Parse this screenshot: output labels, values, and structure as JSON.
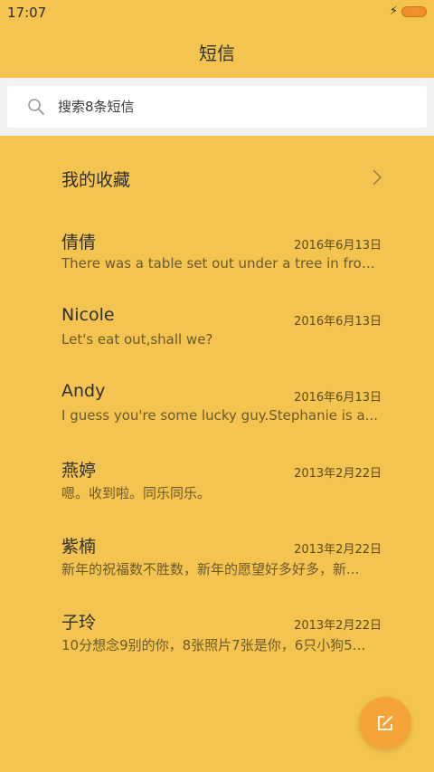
{
  "status_bar": {
    "time": "17:07",
    "icons": [
      "charging-bolt-icon",
      "battery-icon"
    ],
    "battery_color": "#F08F2B"
  },
  "header": {
    "title": "短信"
  },
  "search": {
    "placeholder": "搜索8条短信"
  },
  "favorites": {
    "label": "我的收藏"
  },
  "conversations": [
    {
      "name": "倩倩",
      "date": "2016年6月13日",
      "preview": "There was a table set out under a tree in front..."
    },
    {
      "name": "Nicole",
      "date": "2016年6月13日",
      "preview": "Let's eat out,shall we?"
    },
    {
      "name": "Andy",
      "date": "2016年6月13日",
      "preview": "I guess you're some lucky guy.Stephanie is a..."
    },
    {
      "name": "燕婷",
      "date": "2013年2月22日",
      "preview": "嗯。收到啦。同乐同乐。"
    },
    {
      "name": "紫楠",
      "date": "2013年2月22日",
      "preview": "新年的祝福数不胜数，新年的愿望好多好多，新..."
    },
    {
      "name": "子玲",
      "date": "2013年2月22日",
      "preview": "10分想念9别的你，8张照片7张是你，6只小狗5..."
    }
  ],
  "colors": {
    "background": "#F3C44F",
    "compose_button": "#F5A43A",
    "search_strip": "#F2F2F2"
  },
  "compose": {
    "icon": "compose-icon"
  }
}
